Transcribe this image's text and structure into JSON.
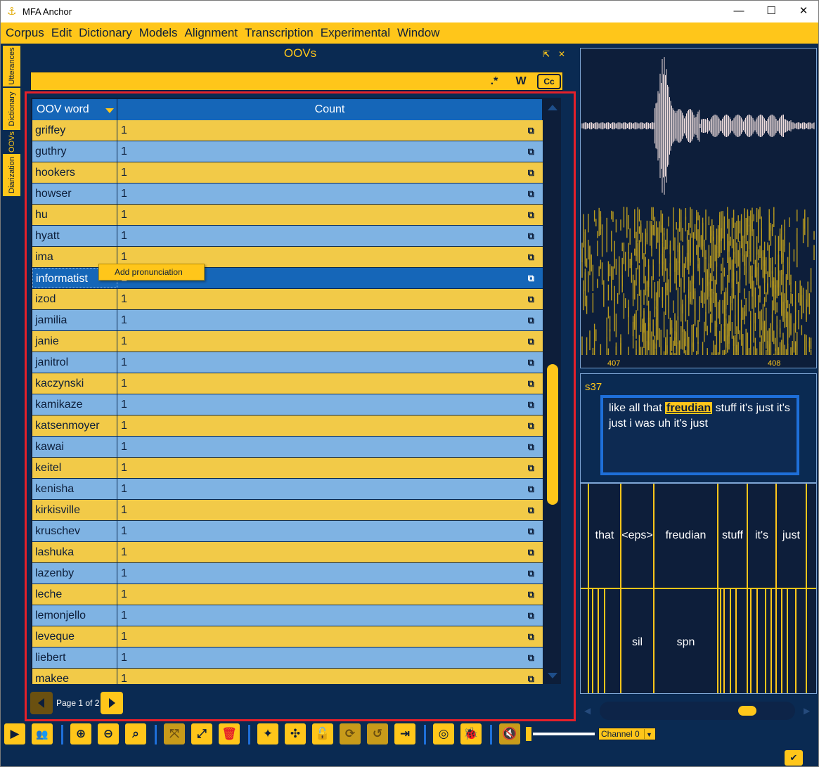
{
  "app": {
    "title": "MFA Anchor",
    "window_controls": [
      "—",
      "☐",
      "✕"
    ]
  },
  "menu": [
    "Corpus",
    "Edit",
    "Dictionary",
    "Models",
    "Alignment",
    "Transcription",
    "Experimental",
    "Window"
  ],
  "side_tabs": [
    "Utterances",
    "Dictionary",
    "OOVs",
    "Diarization"
  ],
  "oov_panel": {
    "title": "OOVs",
    "search": {
      "value": "",
      "regex_label": ".*",
      "word_label": "W",
      "case_label": "Cc"
    },
    "columns": [
      "OOV word",
      "Count"
    ],
    "rows": [
      {
        "word": "griffey",
        "count": "1"
      },
      {
        "word": "guthry",
        "count": "1"
      },
      {
        "word": "hookers",
        "count": "1"
      },
      {
        "word": "howser",
        "count": "1"
      },
      {
        "word": "hu",
        "count": "1"
      },
      {
        "word": "hyatt",
        "count": "1"
      },
      {
        "word": "ima",
        "count": "1"
      },
      {
        "word": "informatist",
        "count": "1",
        "selected": true
      },
      {
        "word": "izod",
        "count": "1"
      },
      {
        "word": "jamilia",
        "count": "1"
      },
      {
        "word": "janie",
        "count": "1"
      },
      {
        "word": "janitrol",
        "count": "1"
      },
      {
        "word": "kaczynski",
        "count": "1"
      },
      {
        "word": "kamikaze",
        "count": "1"
      },
      {
        "word": "katsenmoyer",
        "count": "1"
      },
      {
        "word": "kawai",
        "count": "1"
      },
      {
        "word": "keitel",
        "count": "1"
      },
      {
        "word": "kenisha",
        "count": "1"
      },
      {
        "word": "kirkisville",
        "count": "1"
      },
      {
        "word": "kruschev",
        "count": "1"
      },
      {
        "word": "lashuka",
        "count": "1"
      },
      {
        "word": "lazenby",
        "count": "1"
      },
      {
        "word": "leche",
        "count": "1"
      },
      {
        "word": "lemonjello",
        "count": "1"
      },
      {
        "word": "leveque",
        "count": "1"
      },
      {
        "word": "liebert",
        "count": "1"
      },
      {
        "word": "makee",
        "count": "1"
      }
    ],
    "context_menu": "Add pronunciation",
    "pagination": "Page 1 of 2"
  },
  "waveform": {
    "ticks": [
      "407",
      "408"
    ]
  },
  "utterance": {
    "speaker": "s37",
    "text_before": "like all that ",
    "highlight": "freudian",
    "text_after": " stuff it's just it's just i was uh it's just"
  },
  "word_tier": [
    "that",
    "<eps>",
    "freudian",
    "stuff",
    "it's",
    "just"
  ],
  "phone_tier": [
    "sil",
    "spn"
  ],
  "channel": "Channel 0",
  "colors": {
    "accent": "#ffc61a",
    "background": "#0a2a52",
    "selected_row": "#1566b8",
    "highlight_border": "#e5202a"
  }
}
